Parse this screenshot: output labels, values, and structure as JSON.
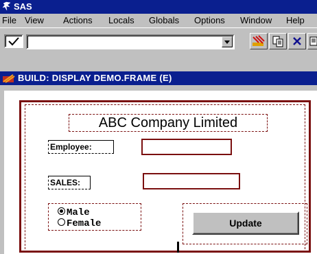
{
  "app": {
    "title": "SAS"
  },
  "menu": [
    "File",
    "View",
    "Actions",
    "Locals",
    "Globals",
    "Options",
    "Window",
    "Help"
  ],
  "toolbar": {
    "command_value": ""
  },
  "build_window": {
    "title": "BUILD: DISPLAY DEMO.FRAME (E)"
  },
  "form": {
    "company_text": "ABC Company Limited",
    "employee_label": "Employee:",
    "employee_value": "",
    "sales_label": "SALES:",
    "sales_value": "",
    "gender_options": [
      "Male",
      "Female"
    ],
    "gender_selected": "Male",
    "update_label": "Update"
  },
  "colors": {
    "titlebar": "#0a1f8f",
    "chrome": "#c0c0c0",
    "frame_border": "#7a0f0f"
  },
  "icons": [
    "sas-logo-icon",
    "checkmark-icon",
    "dropdown-arrow-icon",
    "paint-icon",
    "copy-icon",
    "close-icon",
    "paste-icon",
    "build-frame-icon"
  ]
}
